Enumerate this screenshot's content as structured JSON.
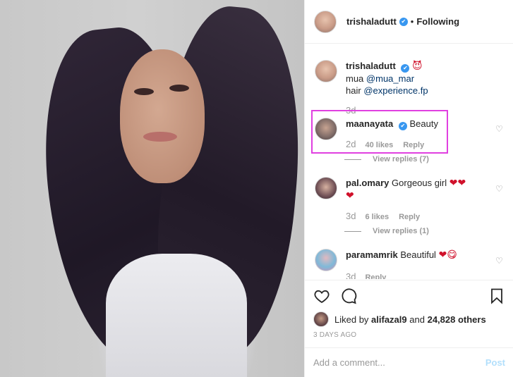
{
  "post": {
    "author": "trishaladutt",
    "separator": "•",
    "follow_status": "Following",
    "verified_mark": "✔"
  },
  "caption": {
    "username": "trishaladutt",
    "emoji": "😈",
    "line1_prefix": "mua",
    "line1_mention": "@mua_mar",
    "line2_prefix": "hair",
    "line2_mention": "@experience.fp",
    "age": "3d"
  },
  "comments": [
    {
      "username": "maanayata",
      "verified": true,
      "text": "Beauty",
      "age": "2d",
      "likes": "40 likes",
      "reply": "Reply",
      "view_replies": "View replies (7)"
    },
    {
      "username": "pal.omary",
      "verified": false,
      "text": "Gorgeous girl",
      "emoji": "❤❤❤",
      "age": "3d",
      "likes": "6 likes",
      "reply": "Reply",
      "view_replies": "View replies (1)"
    },
    {
      "username": "paramamrik",
      "verified": false,
      "text": "Beautiful",
      "emoji": "❤😋",
      "age": "3d",
      "likes": "",
      "reply": "Reply"
    }
  ],
  "like_icon": "♡",
  "actions": {
    "icons": [
      "heart-icon",
      "comment-icon",
      "bookmark-icon"
    ]
  },
  "liked_by": {
    "prefix": "Liked by",
    "user": "alifazal9",
    "conj": "and",
    "others": "24,828 others"
  },
  "time_ago": "3 DAYS AGO",
  "add_comment": {
    "placeholder": "Add a comment...",
    "post_label": "Post"
  },
  "colors": {
    "verified": "#3897f0",
    "mention": "#003569",
    "highlight": "#e040e0",
    "post_disabled": "#b2dffc"
  }
}
